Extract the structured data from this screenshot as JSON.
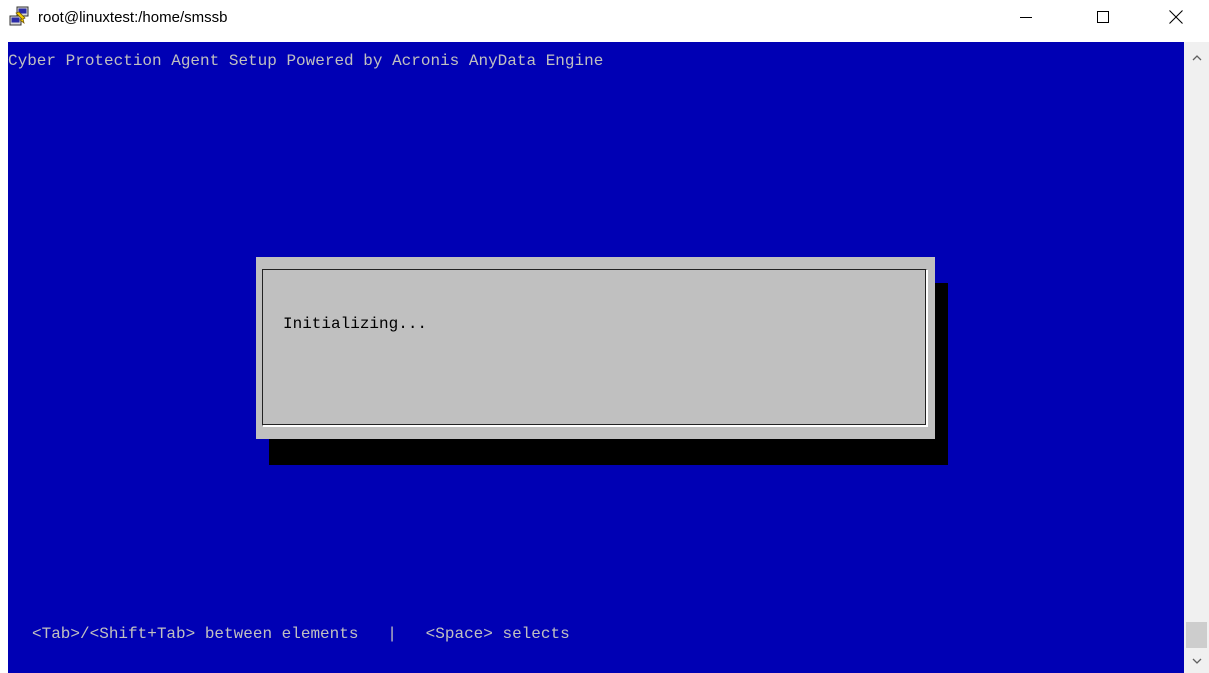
{
  "window": {
    "title": "root@linuxtest:/home/smssb",
    "app_icon": "putty-icon",
    "controls": {
      "minimize": "minimize-icon",
      "maximize": "maximize-icon",
      "close": "close-icon"
    }
  },
  "terminal": {
    "header": "Cyber Protection Agent Setup Powered by Acronis AnyData Engine",
    "dialog": {
      "message": "Initializing..."
    },
    "help_line": "<Tab>/<Shift+Tab> between elements   |   <Space> selects",
    "colors": {
      "background": "#0000b4",
      "text": "#c0c0c0",
      "dialog_background": "#c0c0c0",
      "dialog_text": "#000000",
      "shadow": "#000000"
    }
  },
  "scrollbar": {
    "up_icon": "chevron-up-icon",
    "down_icon": "chevron-down-icon"
  }
}
